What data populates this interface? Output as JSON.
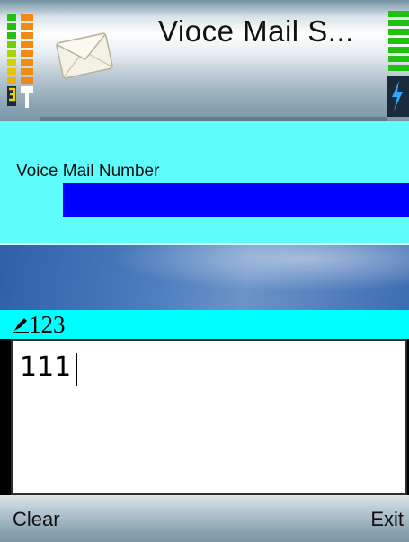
{
  "titlebar": {
    "title": "Vioce Mail S...",
    "app_icon": "envelope-icon",
    "signal_icon": "signal-strength-icon",
    "battery_icon": "battery-icon"
  },
  "form": {
    "voice_mail_label": "Voice Mail Number",
    "field_highlight_color": "#0000ff",
    "background_color": "#5ffcfc"
  },
  "input_mode": {
    "icon": "pen-icon",
    "label": "123",
    "bar_color": "#00ffff"
  },
  "editor": {
    "value": "111"
  },
  "softkeys": {
    "left": "Clear",
    "right": "Exit"
  }
}
